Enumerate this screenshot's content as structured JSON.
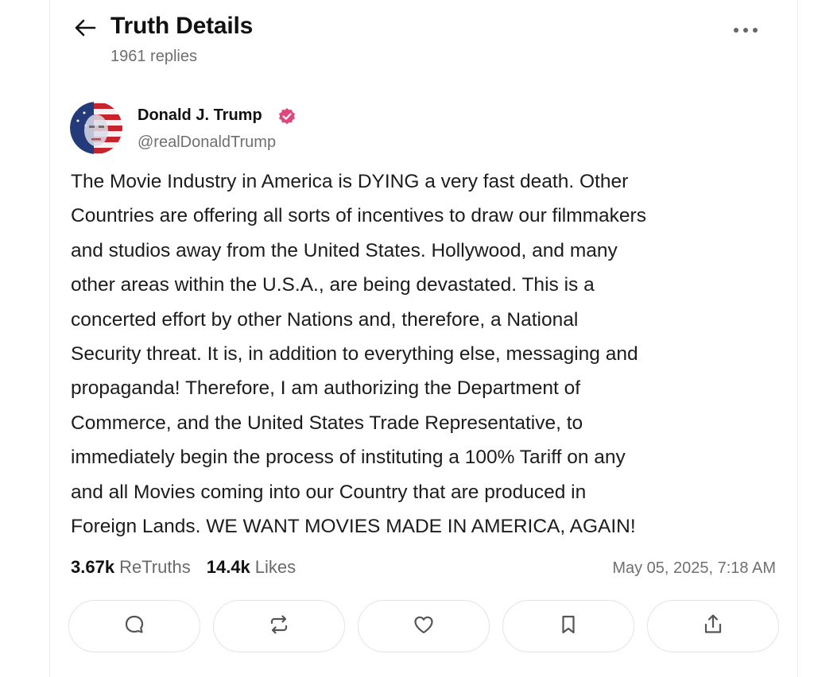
{
  "header": {
    "title": "Truth Details",
    "replies": "1961 replies",
    "back_icon": "arrow-left-icon",
    "more_icon": "more-dots-icon"
  },
  "post": {
    "author_name": "Donald J. Trump",
    "author_handle": "@realDonaldTrump",
    "verified_color": "#e0457b",
    "body": "The Movie Industry in America is DYING a very fast death. Other\nCountries are offering all sorts of incentives to draw our filmmakers\nand studios away from the United States. Hollywood, and many\nother areas within the U.S.A., are being devastated. This is a\nconcerted effort by other Nations and, therefore, a National\nSecurity threat. It is, in addition to everything else, messaging and\npropaganda! Therefore, I am authorizing the Department of\nCommerce, and the United States Trade Representative, to\nimmediately begin the process of instituting a 100% Tariff on any\nand all Movies coming into our Country that are produced in\nForeign Lands. WE WANT MOVIES MADE IN AMERICA, AGAIN!",
    "retruths_count": "3.67k",
    "retruths_label": "ReTruths",
    "likes_count": "14.4k",
    "likes_label": "Likes",
    "timestamp": "May 05, 2025, 7:18 AM"
  },
  "actions": [
    {
      "icon": "reply-bubble-icon"
    },
    {
      "icon": "retruth-repeat-icon"
    },
    {
      "icon": "like-heart-icon"
    },
    {
      "icon": "bookmark-icon"
    },
    {
      "icon": "share-upload-icon"
    }
  ]
}
